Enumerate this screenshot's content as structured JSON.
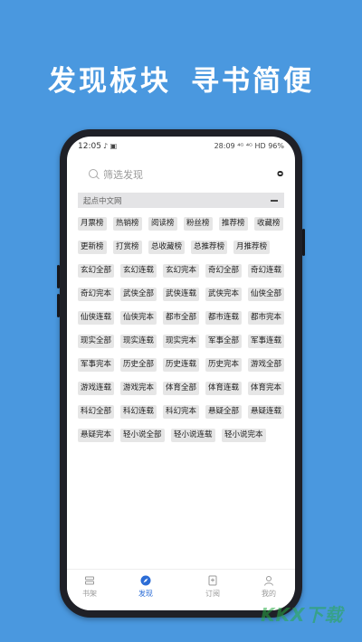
{
  "headline": {
    "left": "发现板块",
    "right": "寻书简便"
  },
  "status": {
    "time": "12:05",
    "right": "28:09 ⁴ᴳ ⁴ᴳ HD 96%"
  },
  "search": {
    "placeholder": "筛选发现",
    "scan_label": "ᴑ"
  },
  "section": {
    "title": "起点中文网"
  },
  "tags": [
    "月票榜",
    "热销榜",
    "阅读榜",
    "粉丝榜",
    "推荐榜",
    "收藏榜",
    "更新榜",
    "打赏榜",
    "总收藏榜",
    "总推荐榜",
    "月推荐榜",
    "玄幻全部",
    "玄幻连载",
    "玄幻完本",
    "奇幻全部",
    "奇幻连载",
    "奇幻完本",
    "武侠全部",
    "武侠连载",
    "武侠完本",
    "仙侠全部",
    "仙侠连载",
    "仙侠完本",
    "都市全部",
    "都市连载",
    "都市完本",
    "现实全部",
    "现实连载",
    "现实完本",
    "军事全部",
    "军事连载",
    "军事完本",
    "历史全部",
    "历史连载",
    "历史完本",
    "游戏全部",
    "游戏连载",
    "游戏完本",
    "体育全部",
    "体育连载",
    "体育完本",
    "科幻全部",
    "科幻连载",
    "科幻完本",
    "悬疑全部",
    "悬疑连载",
    "悬疑完本",
    "轻小说全部",
    "轻小说连载",
    "轻小说完本"
  ],
  "tabs": [
    {
      "label": "书架",
      "icon": "bookshelf-icon"
    },
    {
      "label": "发现",
      "icon": "compass-icon"
    },
    {
      "label": "订阅",
      "icon": "subscribe-icon"
    },
    {
      "label": "我的",
      "icon": "profile-icon"
    }
  ],
  "watermark": "KKX下载",
  "colors": {
    "background": "#4a98df",
    "accent": "#2b6cd6"
  }
}
